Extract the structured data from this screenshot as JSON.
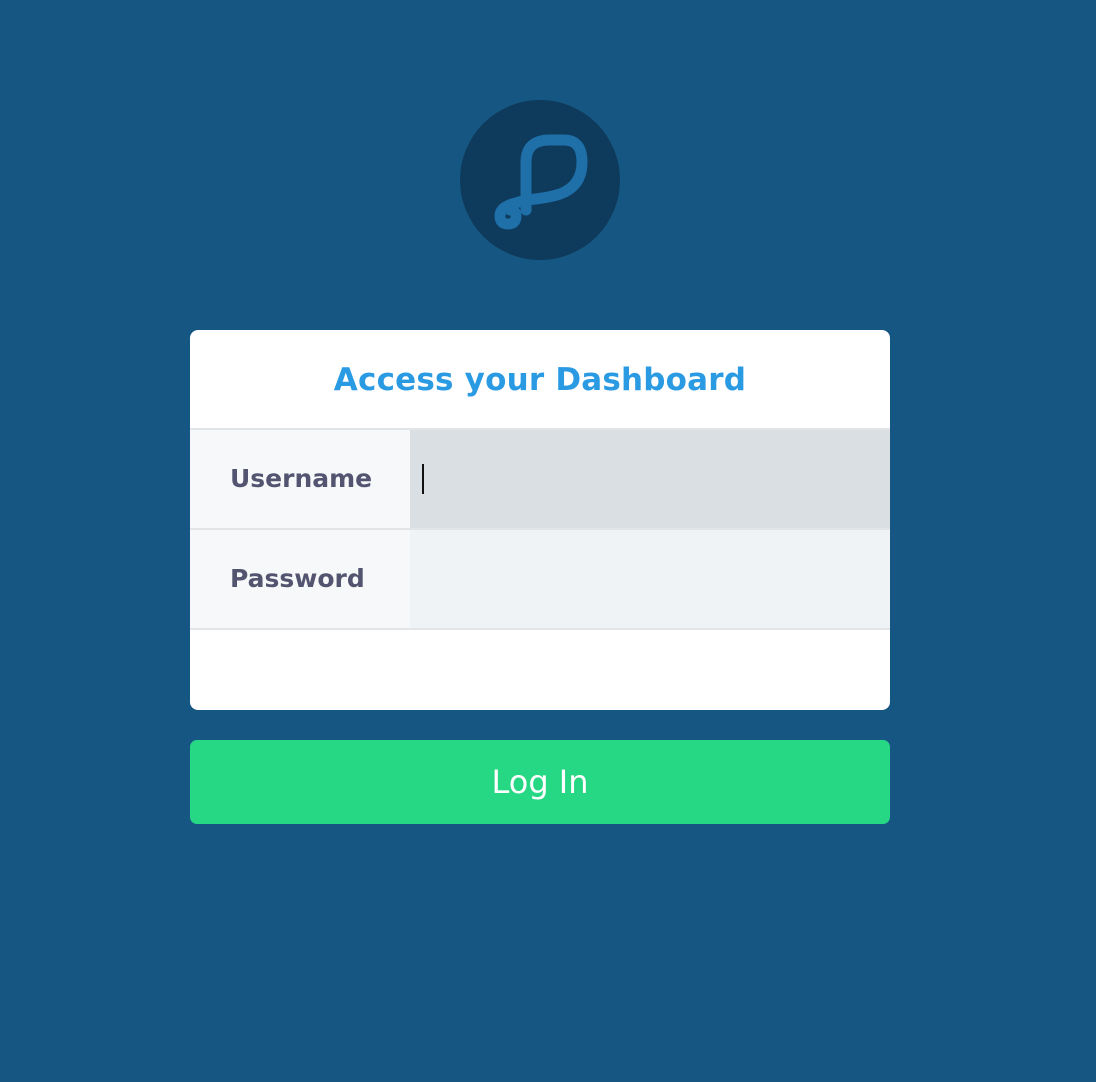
{
  "logo": {
    "icon": "app-logo-icon",
    "circle_color": "#0e3a5c",
    "mark_color": "#1f6fa8"
  },
  "login_form": {
    "title": "Access your Dashboard",
    "username_label": "Username",
    "username_value": "",
    "password_label": "Password",
    "password_value": "",
    "submit_label": "Log In"
  },
  "colors": {
    "background": "#155782",
    "title": "#2a9be3",
    "label": "#535470",
    "button": "#26d883"
  }
}
